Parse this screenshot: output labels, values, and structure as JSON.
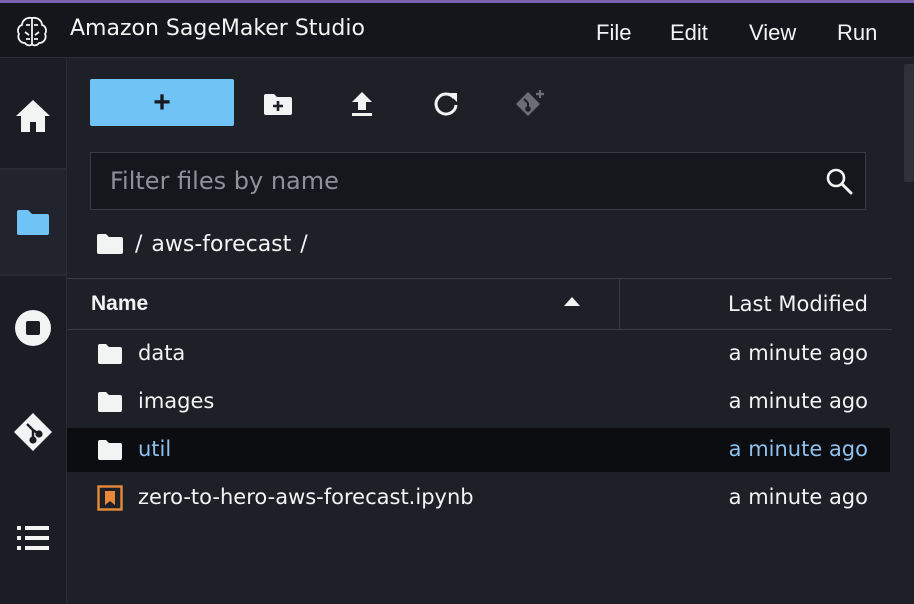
{
  "app": {
    "title": "Amazon SageMaker Studio"
  },
  "menu": {
    "items": [
      "File",
      "Edit",
      "View",
      "Run"
    ]
  },
  "sidebar": {
    "items": [
      {
        "name": "home",
        "icon": "home-icon"
      },
      {
        "name": "file-browser",
        "icon": "folder-icon",
        "active": true
      },
      {
        "name": "running-terminals-kernels",
        "icon": "stop-circle-icon"
      },
      {
        "name": "git",
        "icon": "git-icon"
      },
      {
        "name": "table-of-contents",
        "icon": "list-icon"
      }
    ]
  },
  "toolbar": {
    "new_label": "+",
    "buttons": [
      "new-folder-icon",
      "upload-icon",
      "refresh-icon",
      "git-clone-icon"
    ]
  },
  "filter": {
    "placeholder": "Filter files by name",
    "value": ""
  },
  "breadcrumb": {
    "root_sep": "/",
    "folder": "aws-forecast",
    "trail_sep": "/"
  },
  "table": {
    "columns": {
      "name": "Name",
      "modified": "Last Modified"
    },
    "rows": [
      {
        "name": "data",
        "type": "folder",
        "modified": "a minute ago"
      },
      {
        "name": "images",
        "type": "folder",
        "modified": "a minute ago"
      },
      {
        "name": "util",
        "type": "folder",
        "modified": "a minute ago",
        "selected": true
      },
      {
        "name": "zero-to-hero-aws-forecast.ipynb",
        "type": "notebook",
        "modified": "a minute ago"
      }
    ]
  },
  "colors": {
    "accent": "#6fc3f5",
    "selected_text": "#8fc1ee",
    "sidebar_active_icon": "#6fc3f5",
    "notebook_icon": "#e8893a",
    "top_accent_line": "#7b5fb3"
  }
}
